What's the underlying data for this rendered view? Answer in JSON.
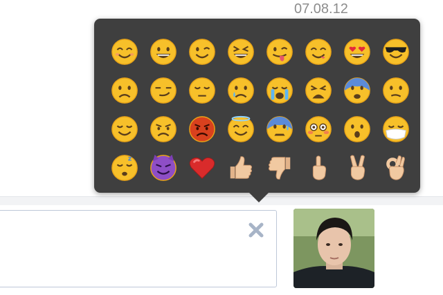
{
  "header": {
    "date": "07.08.12"
  },
  "emoji_picker": {
    "emojis": [
      "smiling-face",
      "grinning-face",
      "winking-face",
      "laughing-face",
      "tongue-wink-face",
      "yum-face",
      "heart-eyes-face",
      "sunglasses-face",
      "disappointed-face",
      "smirking-face",
      "pensive-face",
      "crying-face",
      "sobbing-face",
      "weary-face",
      "fearful-face",
      "confused-face",
      "relieved-face",
      "angry-face",
      "pouting-face",
      "halo-face",
      "cold-sweat-face",
      "flushed-face",
      "surprised-face",
      "mask-face",
      "sleeping-face",
      "devil-face",
      "red-heart",
      "thumbs-up",
      "thumbs-down",
      "pointing-up",
      "victory-hand",
      "ok-hand"
    ]
  },
  "composer": {
    "value": "",
    "placeholder": ""
  },
  "avatar": {
    "icon": "user-avatar"
  },
  "colors": {
    "popup_background": "#3f3f3f",
    "emoji_yellow": "#f7c02a",
    "input_border": "#bdc7d8",
    "clear_icon": "#a7b4c7"
  }
}
